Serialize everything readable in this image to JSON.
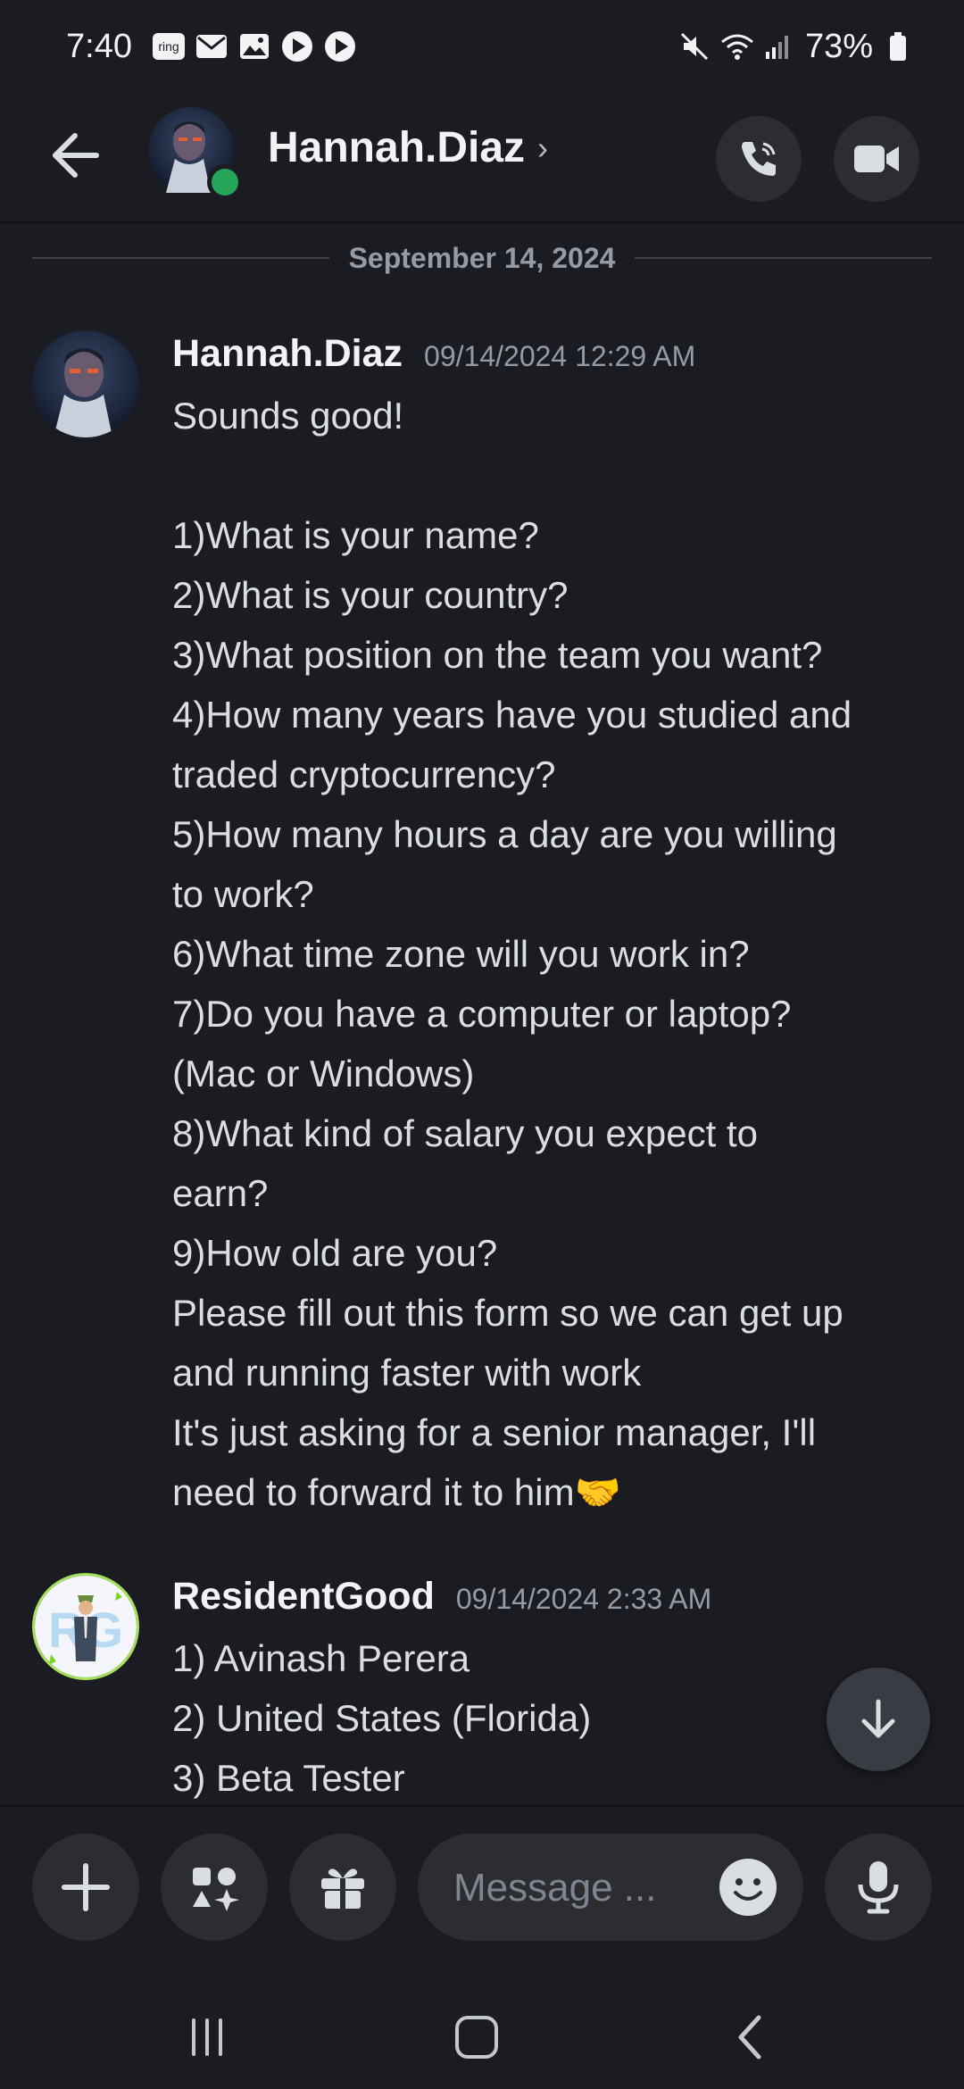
{
  "status_bar": {
    "time": "7:40",
    "notification_icons": [
      "ring-app-icon",
      "gmail-icon",
      "gallery-icon",
      "play-icon",
      "play-icon"
    ],
    "ring_label": "ring",
    "battery": "73%"
  },
  "header": {
    "contact_name": "Hannah.Diaz",
    "status": "online"
  },
  "date_divider": "September 14, 2024",
  "messages": [
    {
      "author": "Hannah.Diaz",
      "timestamp": "09/14/2024 12:29 AM",
      "lines": [
        "Sounds good!",
        "",
        "1)What is your name?",
        "2)What is your country?",
        "3)What position on the team you want?",
        "4)How many years have you studied and",
        "traded cryptocurrency?",
        "5)How many hours a day are you willing",
        "to work?",
        "6)What time zone will you work in?",
        "7)Do you have a computer or laptop?",
        "(Mac or Windows)",
        "8)What kind of salary you expect to",
        "earn?",
        "9)How old are you?",
        "Please fill out this form so we can get up",
        "and running faster with work",
        "It's just asking for a senior manager, I'll",
        "need to forward it to him🤝"
      ]
    },
    {
      "author": "ResidentGood",
      "timestamp": "09/14/2024 2:33 AM",
      "avatar_text": "RG",
      "lines": [
        "1) Avinash Perera",
        "2) United States (Florida)",
        "3) Beta Tester"
      ]
    }
  ],
  "composer": {
    "placeholder": "Message ..."
  },
  "colors": {
    "background": "#1b1c22",
    "surface": "#2b2d31",
    "online": "#23a55a",
    "muted_text": "#949ba4"
  }
}
